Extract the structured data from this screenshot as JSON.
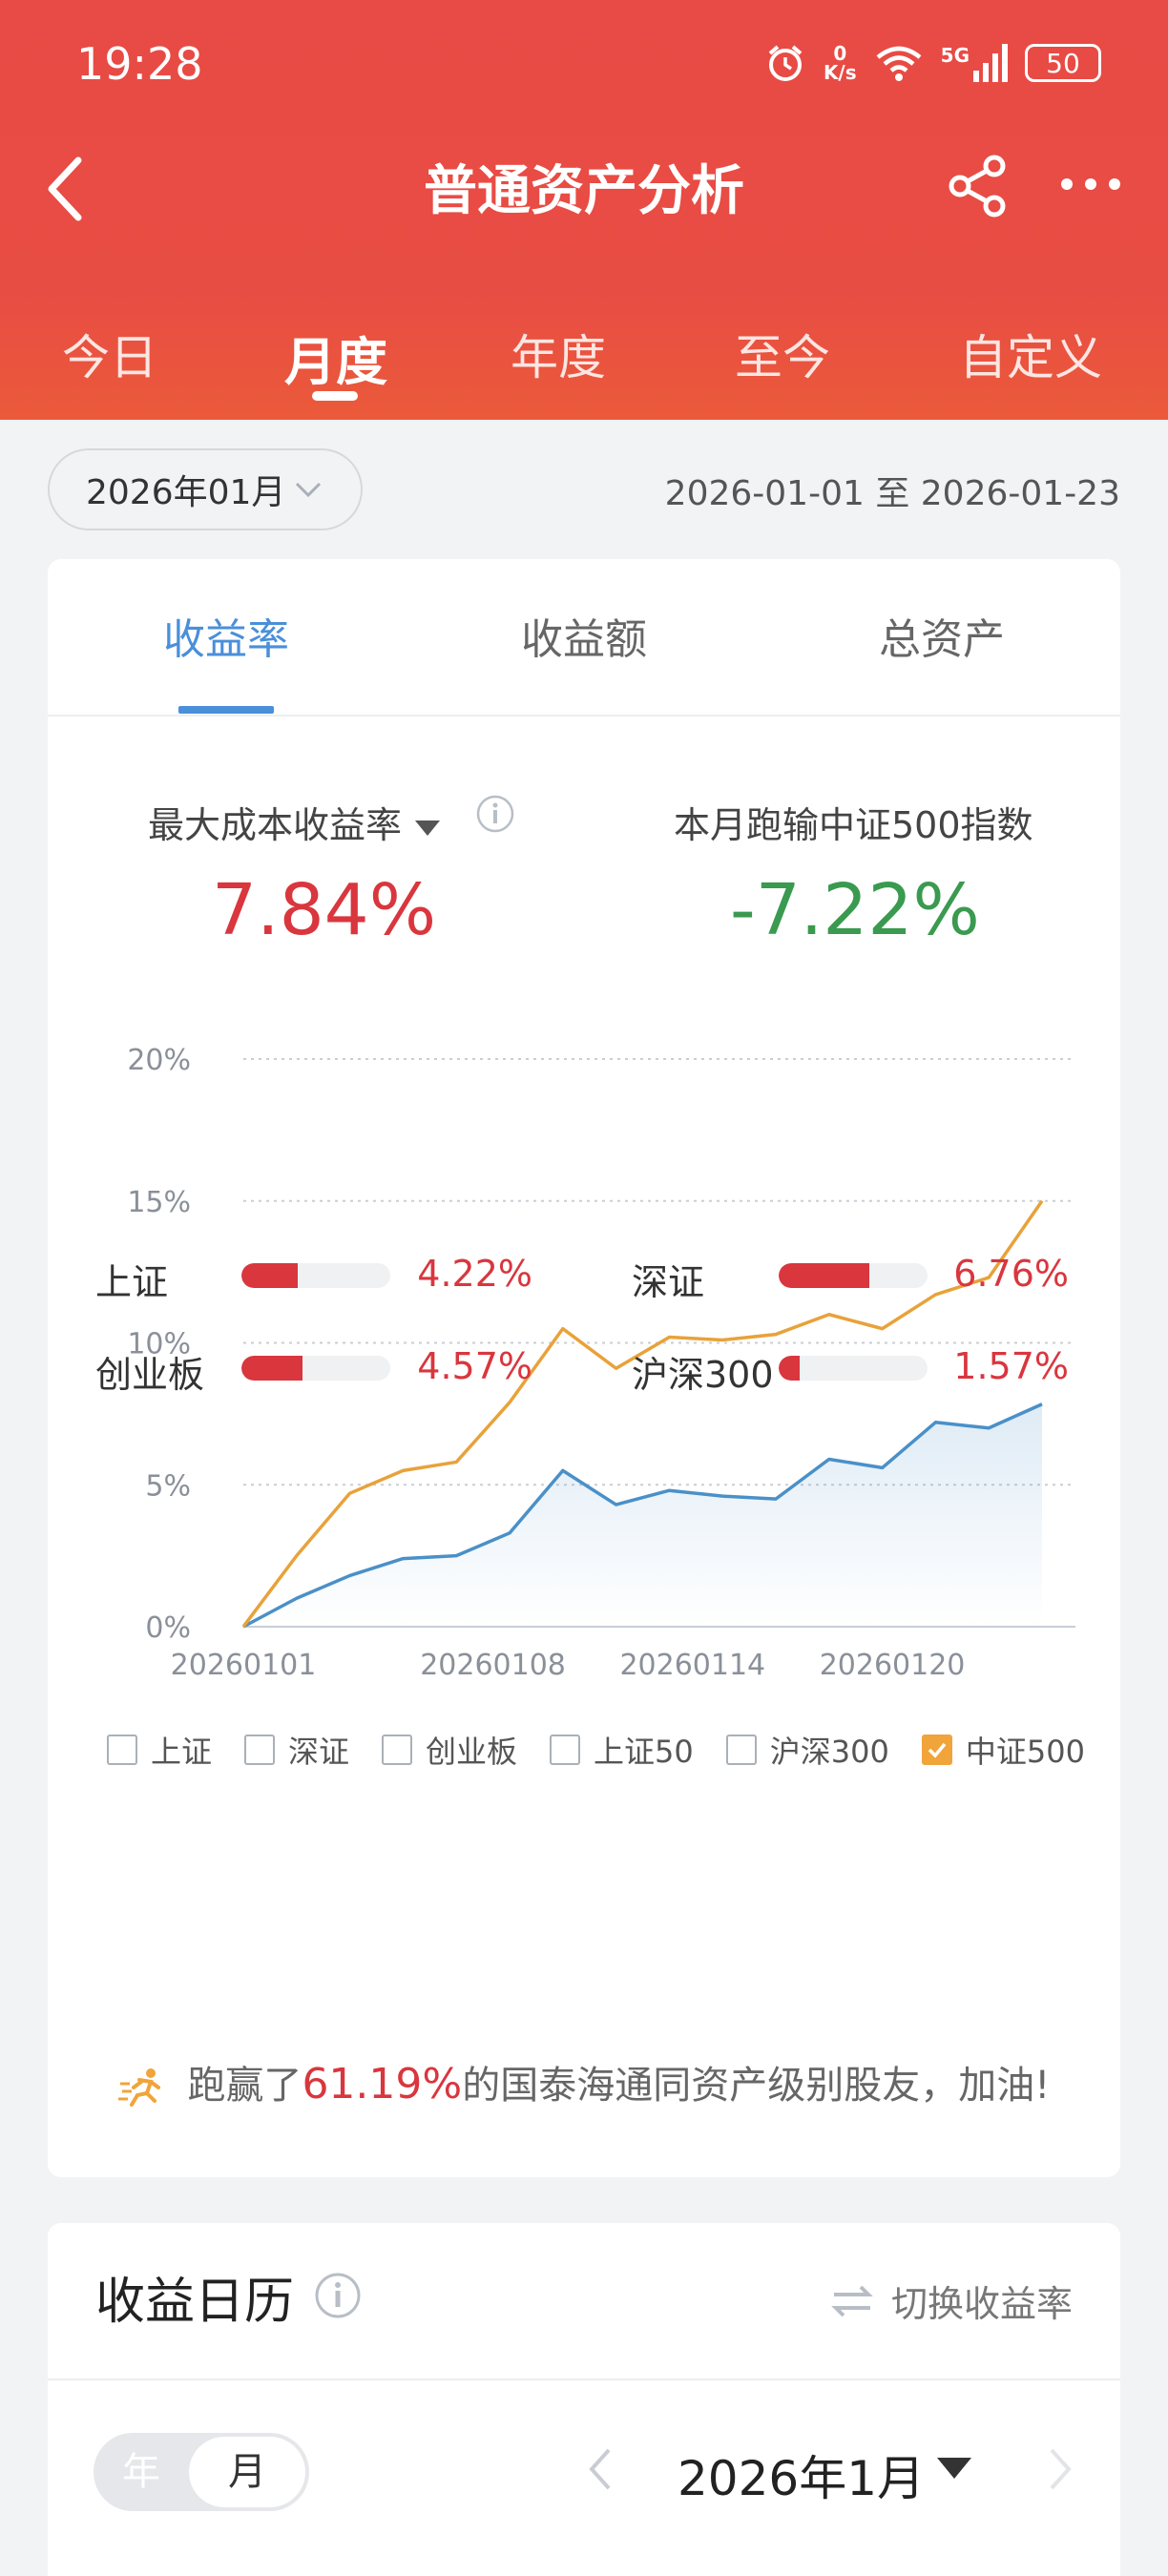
{
  "status_bar": {
    "time": "19:28",
    "net_speed_value": "0",
    "net_speed_unit": "K/s",
    "signal": "5G",
    "battery": "50"
  },
  "nav": {
    "title": "普通资产分析",
    "icons": [
      "back-icon",
      "share-icon",
      "more-icon"
    ]
  },
  "period_tabs": [
    {
      "label": "今日"
    },
    {
      "label": "月度",
      "active": true
    },
    {
      "label": "年度"
    },
    {
      "label": "至今"
    },
    {
      "label": "自定义"
    }
  ],
  "filter": {
    "month": "2026年01月",
    "range": "2026-01-01 至 2026-01-23"
  },
  "metric_tabs": [
    {
      "label": "收益率",
      "active": true
    },
    {
      "label": "收益额"
    },
    {
      "label": "总资产"
    }
  ],
  "stats": {
    "left_label": "最大成本收益率",
    "left_value": "7.84%",
    "right_label": "本月跑输中证500指数",
    "right_value": "-7.22%"
  },
  "chart_data": {
    "type": "line",
    "x": [
      "20260101",
      "20260102",
      "20260105",
      "20260106",
      "20260107",
      "20260108",
      "20260109",
      "20260112",
      "20260113",
      "20260114",
      "20260115",
      "20260116",
      "20260119",
      "20260120",
      "20260121",
      "20260122",
      "20260123"
    ],
    "x_tick_labels": [
      "20260101",
      "20260108",
      "20260114",
      "20260120"
    ],
    "y_tick_labels": [
      "0%",
      "5%",
      "10%",
      "15%",
      "20%"
    ],
    "ylim": [
      0,
      20
    ],
    "y_unit": "%",
    "grid": "horizontal-dotted",
    "series": [
      {
        "color": "#4a90c8",
        "values": [
          0,
          1.0,
          1.8,
          2.4,
          2.5,
          3.3,
          5.5,
          4.3,
          4.8,
          4.6,
          4.5,
          5.9,
          5.6,
          7.2,
          7.0,
          7.84
        ]
      },
      {
        "color": "#e8a23a",
        "values": [
          0,
          2.5,
          4.7,
          5.5,
          5.8,
          7.9,
          10.5,
          9.1,
          10.2,
          10.1,
          10.3,
          11.0,
          10.5,
          11.7,
          12.3,
          15.0
        ]
      }
    ]
  },
  "legend": [
    {
      "label": "上证",
      "checked": false
    },
    {
      "label": "深证",
      "checked": false
    },
    {
      "label": "创业板",
      "checked": false
    },
    {
      "label": "上证50",
      "checked": false
    },
    {
      "label": "沪深300",
      "checked": false
    },
    {
      "label": "中证500",
      "checked": true
    }
  ],
  "indices": [
    {
      "name": "上证",
      "value": "4.22%",
      "ratio": 0.38
    },
    {
      "name": "深证",
      "value": "6.76%",
      "ratio": 0.61
    },
    {
      "name": "创业板",
      "value": "4.57%",
      "ratio": 0.41
    },
    {
      "name": "沪深300",
      "value": "1.57%",
      "ratio": 0.14
    }
  ],
  "beat": {
    "prefix": "跑赢了",
    "percent": "61.19%",
    "suffix": "的国泰海通同资产级别股友，加油!"
  },
  "calendar": {
    "title": "收益日历",
    "switch_label": "切换收益率",
    "toggle_year": "年",
    "toggle_month": "月",
    "current_month": "2026年1月"
  },
  "colors": {
    "brand_red": "#e84a45",
    "accent_blue": "#4a8fd9",
    "up_red": "#d9363e",
    "down_green": "#3a9a4f",
    "orange": "#e8a23a"
  }
}
